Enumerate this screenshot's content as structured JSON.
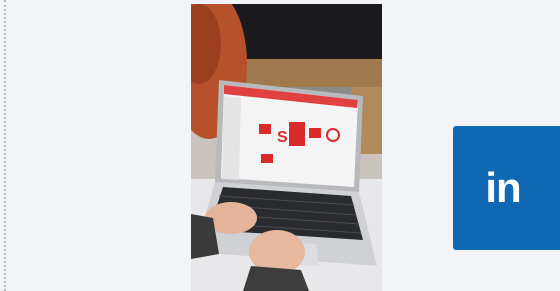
{
  "photo": {
    "icon": "laptop-photo",
    "screen_logo": "S"
  },
  "linkedin": {
    "icon": "linkedin-icon",
    "label": "in",
    "brand_color": "#1168b2"
  }
}
